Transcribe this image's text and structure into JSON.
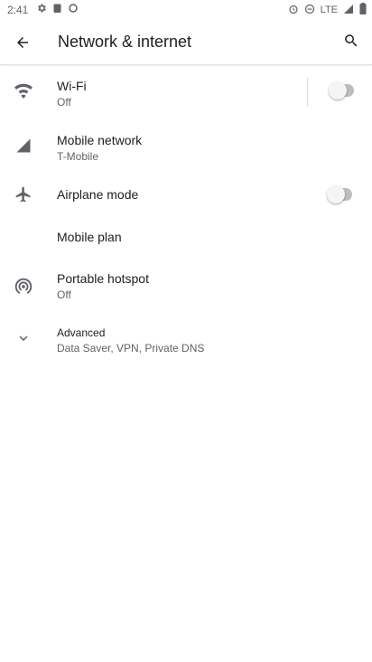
{
  "status_bar": {
    "time": "2:41",
    "network_type": "LTE",
    "left_icons": [
      "settings-notification-icon",
      "clipboard-notification-icon",
      "sync-notification-icon"
    ],
    "right_icons": [
      "alarm-icon",
      "do-not-disturb-icon",
      "signal-icon",
      "battery-icon"
    ]
  },
  "app_bar": {
    "title": "Network & internet"
  },
  "settings": {
    "wifi": {
      "label": "Wi-Fi",
      "summary": "Off",
      "toggle_on": false
    },
    "mobile_network": {
      "label": "Mobile network",
      "summary": "T-Mobile"
    },
    "airplane_mode": {
      "label": "Airplane mode",
      "toggle_on": false
    },
    "mobile_plan": {
      "label": "Mobile plan"
    },
    "hotspot": {
      "label": "Portable hotspot",
      "summary": "Off"
    },
    "advanced": {
      "label": "Advanced",
      "summary": "Data Saver, VPN, Private DNS"
    }
  },
  "colors": {
    "icon": "#5f6368",
    "toggle_track_off": "#bdbdbd",
    "toggle_knob_off": "#f5f5f5"
  }
}
